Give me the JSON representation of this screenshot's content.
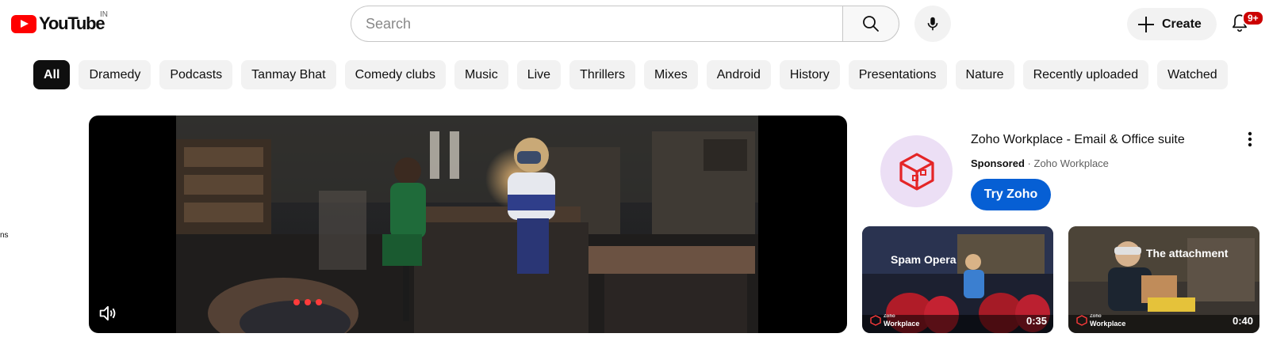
{
  "header": {
    "logo_text": "YouTube",
    "country_code": "IN",
    "search_placeholder": "Search",
    "create_label": "Create",
    "notification_badge": "9+"
  },
  "chips": [
    "All",
    "Dramedy",
    "Podcasts",
    "Tanmay Bhat",
    "Comedy clubs",
    "Music",
    "Live",
    "Thrillers",
    "Mixes",
    "Android",
    "History",
    "Presentations",
    "Nature",
    "Recently uploaded",
    "Watched"
  ],
  "sidebar_fragment": "ns",
  "ad": {
    "title": "Zoho Workplace - Email & Office suite",
    "sponsored_label": "Sponsored",
    "separator": "·",
    "advertiser": "Zoho Workplace",
    "cta_label": "Try Zoho",
    "thumbnails": [
      {
        "caption": "Spam Opera",
        "brand_top": "Zoho",
        "brand_bottom": "Workplace",
        "duration": "0:35"
      },
      {
        "caption": "The attachment",
        "brand_top": "Zoho",
        "brand_bottom": "Workplace",
        "duration": "0:40"
      }
    ]
  },
  "colors": {
    "brand_red": "#ff0000",
    "cta_blue": "#065fd4",
    "chip_active": "#0f0f0f",
    "badge_red": "#cc0000"
  }
}
